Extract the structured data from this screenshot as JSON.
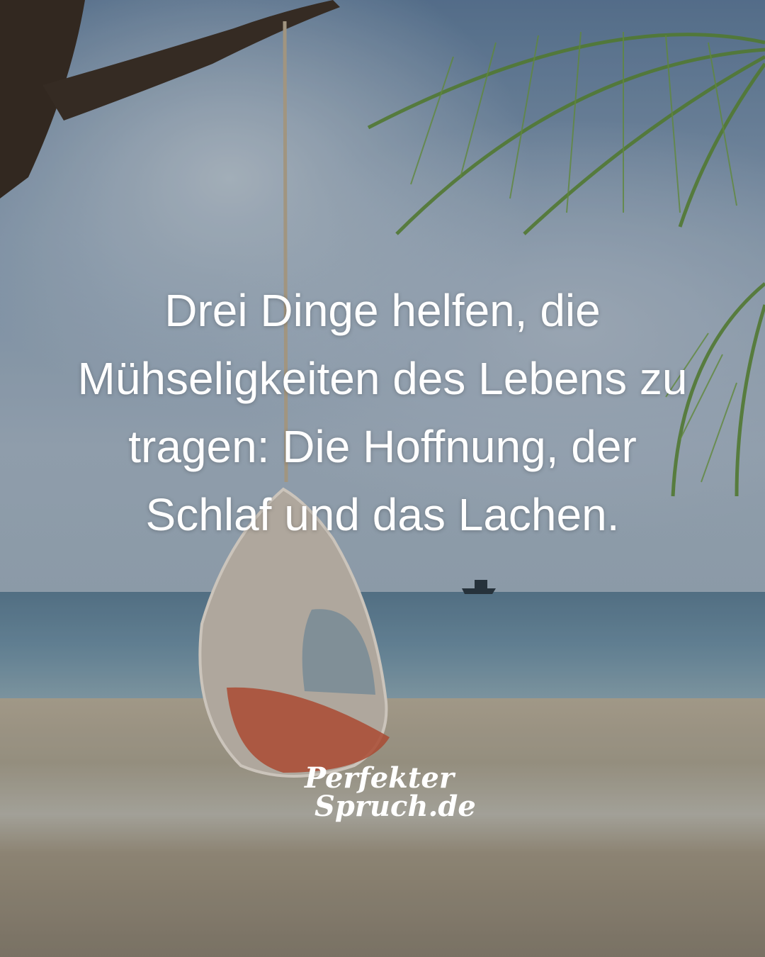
{
  "quote": {
    "lines": [
      "Drei Dinge helfen, die",
      "Mühseligkeiten des Lebens zu",
      "tragen: Die Hoffnung, der",
      "Schlaf und das Lachen."
    ]
  },
  "logo": {
    "line1": "Perfekter",
    "line2": "Spruch.de"
  },
  "colors": {
    "text": "#ffffff",
    "sky": "#8aa0b7",
    "sea": "#6f91a6",
    "sand": "#b7ad9a"
  }
}
